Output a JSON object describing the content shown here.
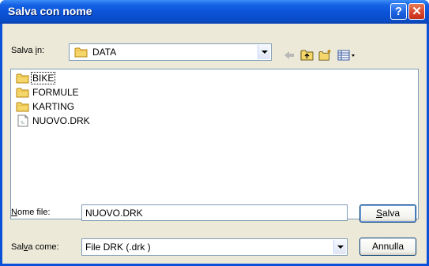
{
  "window": {
    "title": "Salva con nome",
    "help_label": "?",
    "close_label": "✕"
  },
  "save_in": {
    "label_pre": "Salva ",
    "label_key": "i",
    "label_post": "n:",
    "value": "DATA"
  },
  "toolbar": {
    "back_icon": "back-arrow-icon",
    "up_icon": "up-folder-icon",
    "new_folder_icon": "new-folder-icon",
    "views_icon": "views-menu-icon"
  },
  "files": [
    {
      "name": "BIKE",
      "type": "folder"
    },
    {
      "name": "FORMULE",
      "type": "folder"
    },
    {
      "name": "KARTING",
      "type": "folder"
    },
    {
      "name": "NUOVO.DRK",
      "type": "file"
    }
  ],
  "filename": {
    "label_key": "N",
    "label_post": "ome file:",
    "value": "NUOVO.DRK"
  },
  "filetype": {
    "label_pre": "Sal",
    "label_key": "v",
    "label_post": "a come:",
    "value": "File DRK (.drk )"
  },
  "buttons": {
    "save_key": "S",
    "save_post": "alva",
    "cancel": "Annulla"
  },
  "colors": {
    "titlebar": "#0a52d6",
    "face": "#ece9d8",
    "folder": "#f5d66b"
  }
}
